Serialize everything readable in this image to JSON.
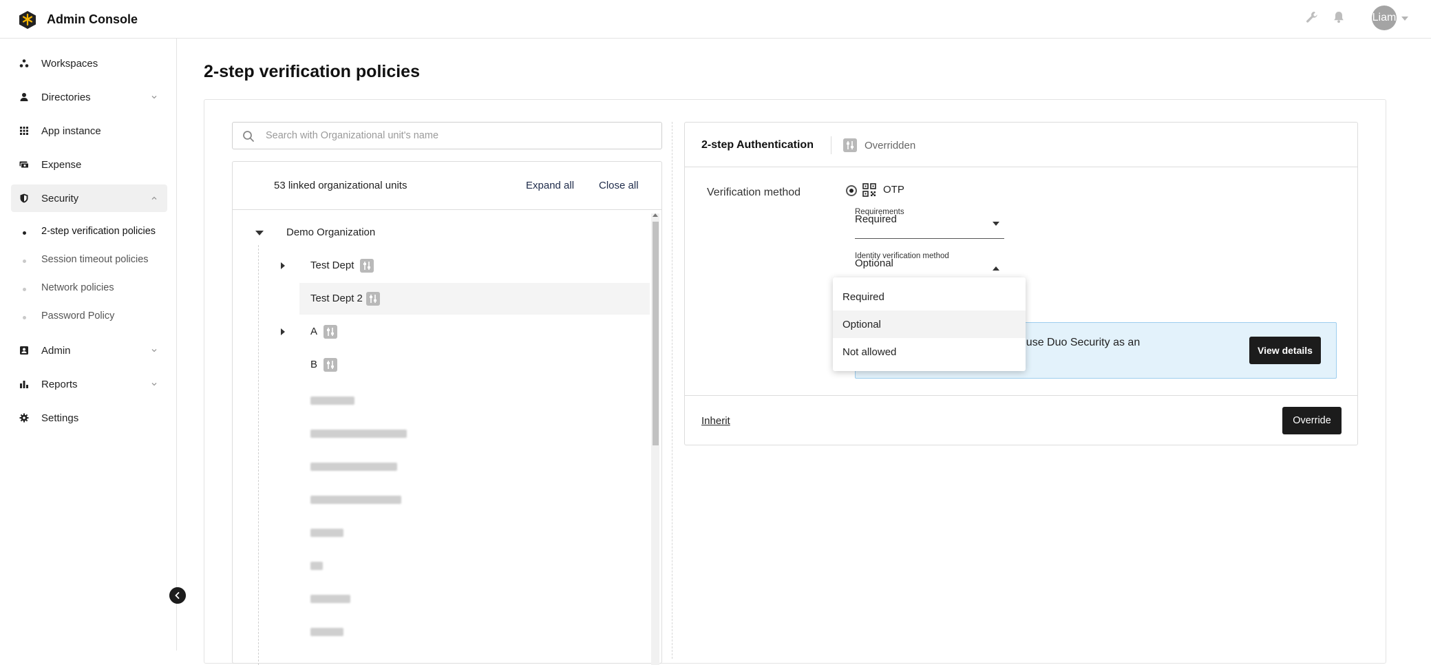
{
  "app": {
    "title": "Admin Console",
    "user_initials": "Liam"
  },
  "sidebar": {
    "items": [
      {
        "label": "Workspaces",
        "icon": "workspaces-icon"
      },
      {
        "label": "Directories",
        "icon": "person-icon"
      },
      {
        "label": "App instance",
        "icon": "grid-icon"
      },
      {
        "label": "Expense",
        "icon": "money-icon"
      },
      {
        "label": "Security",
        "icon": "shield-icon"
      },
      {
        "label": "Admin",
        "icon": "admin-icon"
      },
      {
        "label": "Reports",
        "icon": "bar-chart-icon"
      },
      {
        "label": "Settings",
        "icon": "gear-icon"
      }
    ],
    "security_sub": [
      {
        "label": "2-step verification policies"
      },
      {
        "label": "Session timeout policies"
      },
      {
        "label": "Network policies"
      },
      {
        "label": "Password Policy"
      }
    ]
  },
  "page": {
    "title": "2-step verification policies"
  },
  "tree": {
    "search_placeholder": "Search with Organizational unit's name",
    "linked_count": "53 linked organizational units",
    "expand_all": "Expand all",
    "close_all": "Close all",
    "root": "Demo Organization",
    "nodes": [
      {
        "label": "Test Dept"
      },
      {
        "label": "Test Dept 2"
      },
      {
        "label": "A"
      },
      {
        "label": "B"
      }
    ]
  },
  "auth": {
    "title": "2-step Authentication",
    "status": "Overridden",
    "verification_method_label": "Verification method",
    "method": "OTP",
    "requirements_label": "Requirements",
    "requirements_value": "Required",
    "identity_label": "Identity verification method",
    "identity_value": "Optional",
    "banner_text": "to use Duo Security as an",
    "view_details": "View details",
    "inherit": "Inherit",
    "override": "Override"
  },
  "dropdown": {
    "options": [
      "Required",
      "Optional",
      "Not allowed"
    ],
    "hovered": "Optional"
  }
}
